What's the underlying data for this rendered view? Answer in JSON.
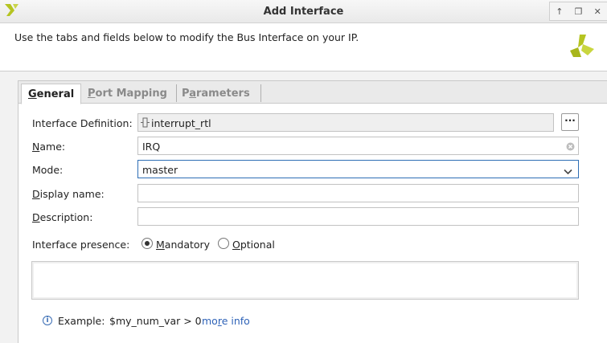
{
  "window": {
    "title": "Add Interface",
    "controls": [
      "↑",
      "❐",
      "✕"
    ]
  },
  "header": {
    "subtitle": "Use the tabs and fields below to modify the Bus Interface on your IP."
  },
  "tabs": [
    {
      "label": "General",
      "mnemonic": "G",
      "rest": "eneral",
      "active": true
    },
    {
      "label": "Port Mapping",
      "mnemonic": "P",
      "rest": "ort Mapping",
      "active": false
    },
    {
      "label": "Parameters",
      "mnemonic": "a",
      "pre": "P",
      "rest": "rameters",
      "active": false
    }
  ],
  "form": {
    "interface_definition": {
      "label": "Interface Definition:",
      "value": "interrupt_rtl",
      "browse": "···"
    },
    "name": {
      "label_mn": "N",
      "label_rest": "ame:",
      "value": "IRQ"
    },
    "mode": {
      "label": "Mode:",
      "value": "master"
    },
    "display_name": {
      "label_mn": "D",
      "label_rest": "isplay name:",
      "value": ""
    },
    "description": {
      "label_mn": "D",
      "label_rest": "escription:",
      "value": ""
    },
    "presence": {
      "label": "Interface presence:",
      "options": [
        {
          "mn": "M",
          "rest": "andatory",
          "checked": true
        },
        {
          "mn": "O",
          "rest": "ptional",
          "checked": false
        }
      ]
    }
  },
  "example": {
    "info_glyph": "i",
    "prefix": "Example:",
    "code": "$my_num_var > 0",
    "link_pre": "mo",
    "link_mn": "r",
    "link_rest": "e info"
  },
  "colors": {
    "accent": "#2e6eb5",
    "link": "#2f63b8",
    "logo": "#b5c421"
  }
}
